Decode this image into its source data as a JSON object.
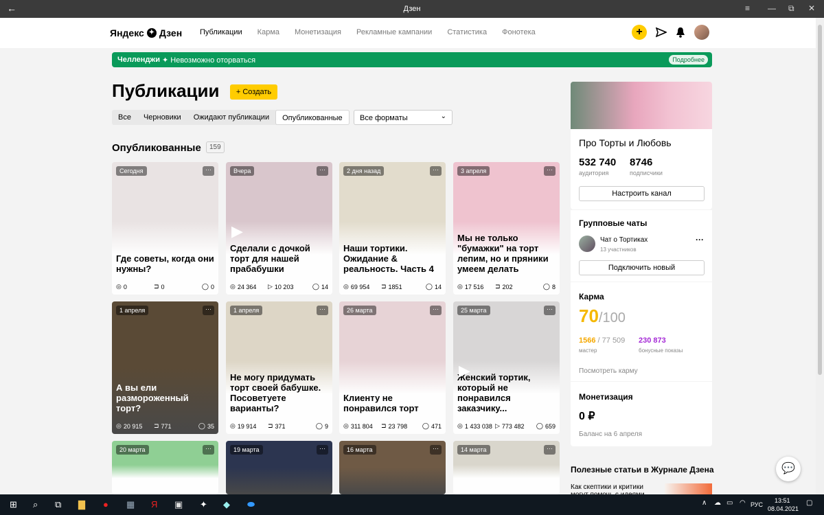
{
  "window": {
    "title": "Дзен"
  },
  "header": {
    "logo": "Яндекс",
    "logo2": "Дзен",
    "nav": [
      "Публикации",
      "Карма",
      "Монетизация",
      "Рекламные кампании",
      "Статистика",
      "Фонотека"
    ]
  },
  "banner": {
    "label": "Челленджи",
    "text": "✦ Невозможно оторваться",
    "more": "Подробнее"
  },
  "page": {
    "title": "Публикации",
    "create": "+ Создать",
    "tabs": [
      "Все",
      "Черновики",
      "Ожидают публикации",
      "Опубликованные"
    ],
    "format": "Все форматы",
    "section": "Опубликованные",
    "count": "159"
  },
  "cards": [
    {
      "date": "Сегодня",
      "title": "Где советы, когда они нужны?",
      "views": "0",
      "reads": "0",
      "comments": "0",
      "light": true,
      "bg": "#e9e3e3",
      "read_icon": "book"
    },
    {
      "date": "Вчера",
      "title": "Сделали с дочкой торт для нашей прабабушки",
      "views": "24 364",
      "reads": "10 203",
      "comments": "14",
      "light": true,
      "bg": "#d9c6cc",
      "read_icon": "play"
    },
    {
      "date": "2 дня назад",
      "title": "Наши тортики. Ожидание & реальность. Часть 4",
      "views": "69 954",
      "reads": "1851",
      "comments": "14",
      "light": true,
      "bg": "#e2dccc",
      "read_icon": "book"
    },
    {
      "date": "3 апреля",
      "title": "Мы не только \"бумажки\" на торт лепим, но и пряники умеем делать",
      "views": "17 516",
      "reads": "202",
      "comments": "8",
      "light": true,
      "bg": "#efc3cf",
      "read_icon": "book"
    },
    {
      "date": "1 апреля",
      "title": "А вы ели размороженный торт?",
      "views": "20 915",
      "reads": "771",
      "comments": "35",
      "light": false,
      "bg": "#5a4a36",
      "read_icon": "book"
    },
    {
      "date": "1 апреля",
      "title": "Не могу придумать торт своей бабушке. Посоветуете варианты?",
      "views": "19 914",
      "reads": "371",
      "comments": "9",
      "light": true,
      "bg": "#ddd6c6",
      "read_icon": "book"
    },
    {
      "date": "26 марта",
      "title": "Клиенту не понравился торт",
      "views": "311 804",
      "reads": "23 798",
      "comments": "471",
      "light": true,
      "bg": "#e7d3d6",
      "read_icon": "book"
    },
    {
      "date": "25 марта",
      "title": "Женский тортик, который не понравился заказчику...",
      "views": "1 433 038",
      "reads": "773 482",
      "comments": "659",
      "light": true,
      "bg": "#d8d6d6",
      "read_icon": "play"
    },
    {
      "date": "20 марта",
      "title": "",
      "views": "",
      "reads": "",
      "comments": "",
      "light": true,
      "bg": "#8fcf94",
      "read_icon": "book"
    },
    {
      "date": "19 марта",
      "title": "",
      "views": "",
      "reads": "",
      "comments": "",
      "light": false,
      "bg": "#2c3550",
      "read_icon": "book"
    },
    {
      "date": "16 марта",
      "title": "",
      "views": "",
      "reads": "",
      "comments": "",
      "light": false,
      "bg": "#6f5a45",
      "read_icon": "book"
    },
    {
      "date": "14 марта",
      "title": "",
      "views": "",
      "reads": "",
      "comments": "",
      "light": true,
      "bg": "#d9d6cc",
      "read_icon": "book"
    }
  ],
  "channel": {
    "name": "Про Торты и Любовь",
    "audience": "532 740",
    "audience_label": "аудитория",
    "subs": "8746",
    "subs_label": "подписчики",
    "settings": "Настроить канал"
  },
  "chats": {
    "title": "Групповые чаты",
    "name": "Чат о Тортиках",
    "members": "13 участников",
    "connect": "Подключить новый"
  },
  "karma": {
    "title": "Карма",
    "value": "70",
    "max": "/100",
    "master": "1566",
    "master_total": " / 77 509",
    "master_label": "мастер",
    "bonus": "230 873",
    "bonus_label": "бонусные показы",
    "link": "Посмотреть карму"
  },
  "money": {
    "title": "Монетизация",
    "value": "0 ₽",
    "balance": "Баланс на 6 апреля"
  },
  "journal": {
    "title": "Полезные статьи в Журнале Дзена",
    "article": "Как скептики и критики могут помочь с идеями"
  },
  "taskbar": {
    "time": "13:51",
    "date": "08.04.2021",
    "lang": "РУС"
  },
  "colors": {
    "accent": "#ffcc00",
    "banner": "#0a9a5a",
    "karma": "#f5b800",
    "bonus": "#a52ad6"
  }
}
